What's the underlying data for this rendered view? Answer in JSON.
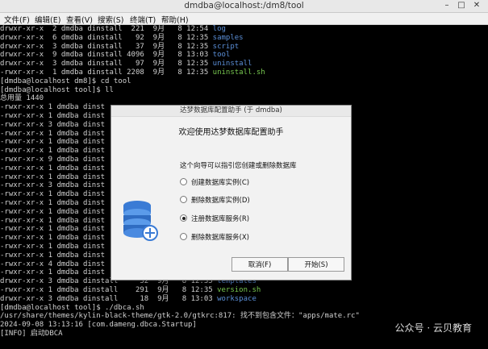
{
  "window": {
    "title": "dmdba@localhost:/dm8/tool"
  },
  "menu": [
    "文件(F)",
    "编辑(E)",
    "查看(V)",
    "搜索(S)",
    "终端(T)",
    "帮助(H)"
  ],
  "terminal_lines": [
    {
      "text": "drwxr-xr-x  2 dmdba dinstall  221  9月   8 12:54 ",
      "name": "log",
      "cls": "c-dir"
    },
    {
      "text": "drwxr-xr-x  6 dmdba dinstall   92  9月   8 12:35 ",
      "name": "samples",
      "cls": "c-dir"
    },
    {
      "text": "drwxr-xr-x  3 dmdba dinstall   37  9月   8 12:35 ",
      "name": "script",
      "cls": "c-dir"
    },
    {
      "text": "drwxr-xr-x  9 dmdba dinstall 4096  9月   8 13:03 ",
      "name": "tool",
      "cls": "c-dir"
    },
    {
      "text": "drwxr-xr-x  3 dmdba dinstall   97  9月   8 12:35 ",
      "name": "uninstall",
      "cls": "c-dir"
    },
    {
      "text": "-rwxr-xr-x  1 dmdba dinstall 2208  9月   8 12:35 ",
      "name": "uninstall.sh",
      "cls": "c-exe"
    },
    {
      "text": "[dmdba@localhost dm8]$ cd tool",
      "name": "",
      "cls": ""
    },
    {
      "text": "[dmdba@localhost tool]$ ll",
      "name": "",
      "cls": ""
    },
    {
      "text": "总用量 1440",
      "name": "",
      "cls": ""
    },
    {
      "text": "-rwxr-xr-x 1 dmdba dinst",
      "name": "",
      "cls": ""
    },
    {
      "text": "-rwxr-xr-x 1 dmdba dinst",
      "name": "",
      "cls": ""
    },
    {
      "text": "-rwxr-xr-x 3 dmdba dinst",
      "name": "",
      "cls": ""
    },
    {
      "text": "-rwxr-xr-x 1 dmdba dinst",
      "name": "",
      "cls": ""
    },
    {
      "text": "-rwxr-xr-x 1 dmdba dinst",
      "name": "",
      "cls": ""
    },
    {
      "text": "-rwxr-xr-x 1 dmdba dinst",
      "name": "",
      "cls": ""
    },
    {
      "text": "-rwxr-xr-x 9 dmdba dinst",
      "name": "",
      "cls": ""
    },
    {
      "text": "-rwxr-xr-x 1 dmdba dinst",
      "name": "",
      "cls": ""
    },
    {
      "text": "-rwxr-xr-x 1 dmdba dinst",
      "name": "",
      "cls": ""
    },
    {
      "text": "-rwxr-xr-x 3 dmdba dinst",
      "name": "",
      "cls": ""
    },
    {
      "text": "-rwxr-xr-x 1 dmdba dinst",
      "name": "",
      "cls": ""
    },
    {
      "text": "-rwxr-xr-x 1 dmdba dinst",
      "name": "",
      "cls": ""
    },
    {
      "text": "-rwxr-xr-x 1 dmdba dinst",
      "name": "",
      "cls": ""
    },
    {
      "text": "-rwxr-xr-x 1 dmdba dinst",
      "name": "",
      "cls": ""
    },
    {
      "text": "-rwxr-xr-x 1 dmdba dinst",
      "name": "",
      "cls": ""
    },
    {
      "text": "-rwxr-xr-x 1 dmdba dinst",
      "name": "",
      "cls": ""
    },
    {
      "text": "-rwxr-xr-x 1 dmdba dinst",
      "name": "",
      "cls": ""
    },
    {
      "text": "-rwxr-xr-x 1 dmdba dinst",
      "name": "",
      "cls": ""
    },
    {
      "text": "-rwxr-xr-x 4 dmdba dinst",
      "name": "",
      "cls": ""
    },
    {
      "text": "-rwxr-xr-x 1 dmdba dinst",
      "name": "",
      "cls": ""
    },
    {
      "text": "drwxr-xr-x 3 dmdba dinstall     32  9月   8 12:35 ",
      "name": "templates",
      "cls": "c-tpl"
    },
    {
      "text": "-rwxr-xr-x 1 dmdba dinstall    291  9月   8 12:35 ",
      "name": "version.sh",
      "cls": "c-exe"
    },
    {
      "text": "drwxr-xr-x 3 dmdba dinstall     18  9月   8 13:03 ",
      "name": "workspace",
      "cls": "c-tpl"
    },
    {
      "text": "[dmdba@localhost tool]$ ./dbca.sh",
      "name": "",
      "cls": ""
    },
    {
      "text": "/usr/share/themes/kylin-black-theme/gtk-2.0/gtkrc:817: 找不到包含文件：\"apps/mate.rc\"",
      "name": "",
      "cls": ""
    },
    {
      "text": "2024-09-08 13:13:16 [com.dameng.dbca.Startup]",
      "name": "",
      "cls": ""
    },
    {
      "text": "[INFO] 启动DBCA",
      "name": "",
      "cls": ""
    }
  ],
  "dialog": {
    "title": "达梦数据库配置助手 (于 dmdba)",
    "welcome": "欢迎使用达梦数据库配置助手",
    "description": "这个向导可以指引您创建或删除数据库",
    "options": [
      {
        "label": "创建数据库实例(C)",
        "selected": false
      },
      {
        "label": "删除数据库实例(D)",
        "selected": false
      },
      {
        "label": "注册数据库服务(R)",
        "selected": true
      },
      {
        "label": "删除数据库服务(X)",
        "selected": false
      }
    ],
    "cancel_label": "取消(F)",
    "start_label": "开始(S)"
  },
  "watermark": "公众号 · 云贝教育"
}
